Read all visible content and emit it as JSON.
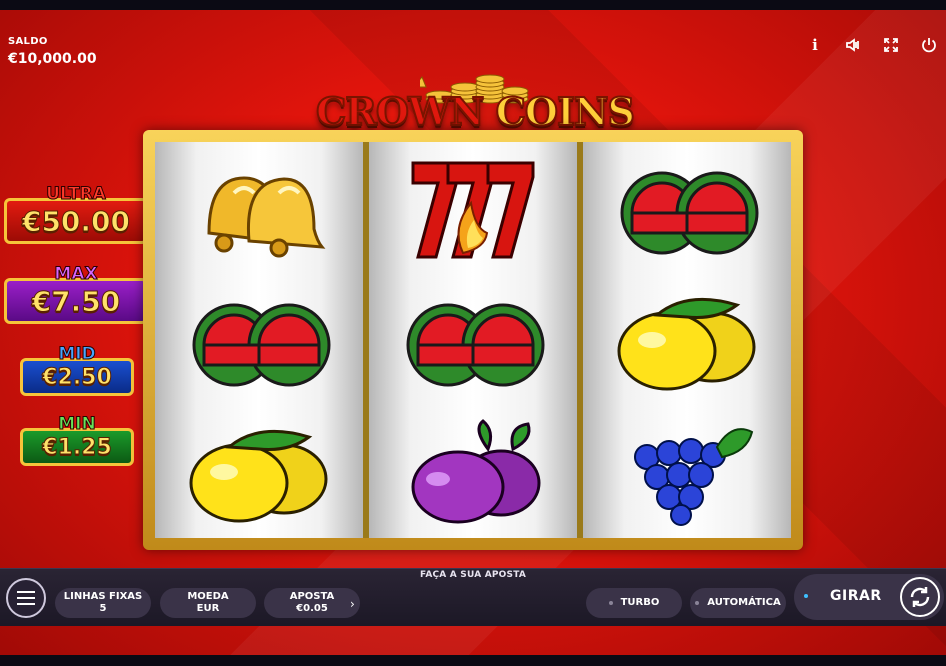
{
  "balance": {
    "label": "SALDO",
    "value": "€10,000.00"
  },
  "top_icons": [
    "info-icon",
    "sound-icon",
    "fullscreen-icon",
    "power-icon"
  ],
  "top_icon_text": {
    "info": "i"
  },
  "logo": {
    "part1": "CROWN",
    "part2": "COINS"
  },
  "jackpots": [
    {
      "name": "ULTRA",
      "value": "€50.00",
      "color": "#e21b10"
    },
    {
      "name": "MAX",
      "value": "€7.50",
      "color": "#9a1fc8"
    },
    {
      "name": "MID",
      "value": "€2.50",
      "color": "#1a4fd0"
    },
    {
      "name": "MIN",
      "value": "€1.25",
      "color": "#1b9a2a"
    }
  ],
  "reels": [
    [
      "bell",
      "watermelon",
      "lemon"
    ],
    [
      "seven",
      "watermelon",
      "plum"
    ],
    [
      "watermelon",
      "lemon",
      "grapes"
    ]
  ],
  "bottom_bar": {
    "hint": "FAÇA A SUA APOSTA",
    "lines": {
      "label": "LINHAS FIXAS",
      "value": "5"
    },
    "coin": {
      "label": "MOEDA",
      "value": "EUR"
    },
    "bet": {
      "label": "APOSTA",
      "value": "€0.05",
      "arrow": "›"
    },
    "turbo": "TURBO",
    "auto": "AUTOMÁTICA",
    "spin": "GIRAR"
  }
}
